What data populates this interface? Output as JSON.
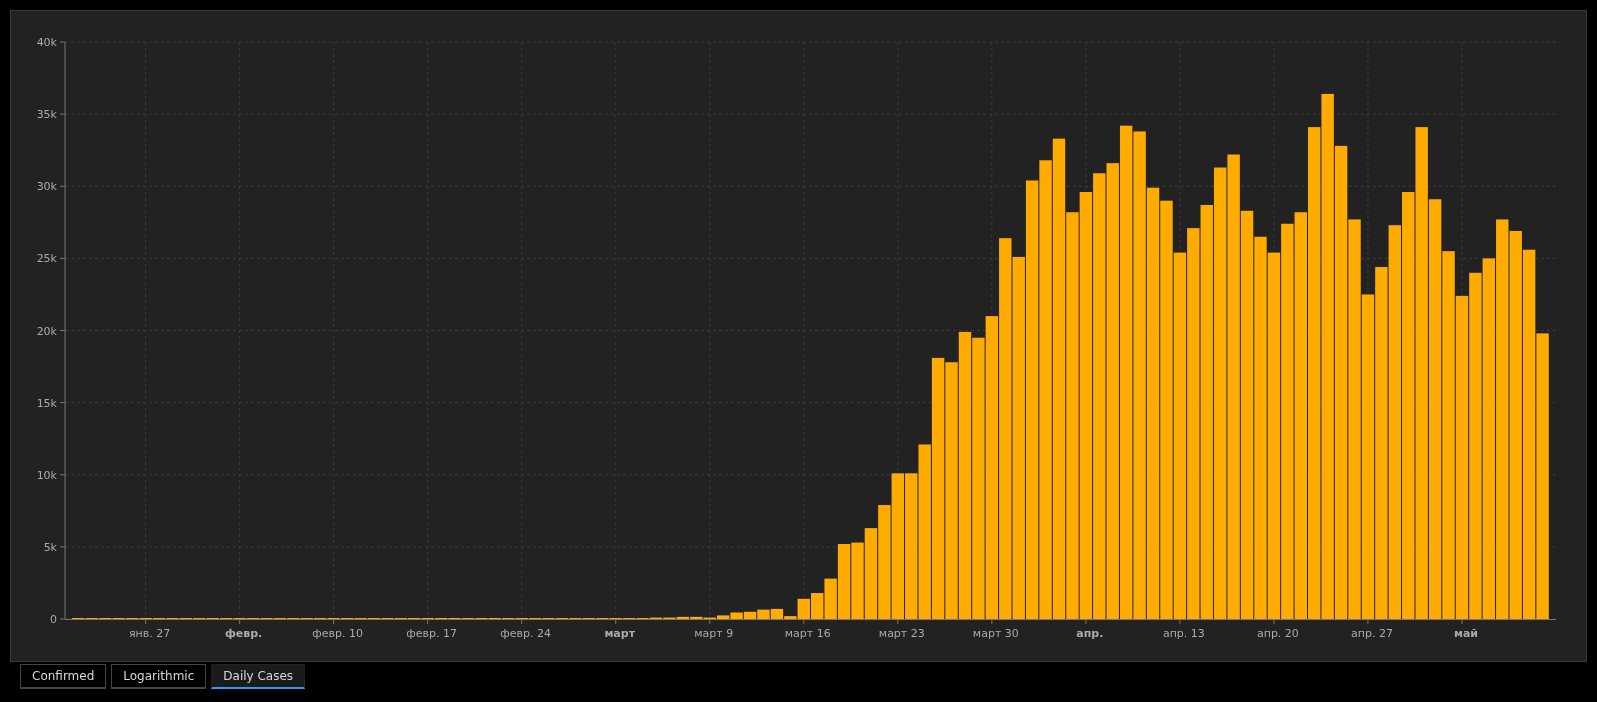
{
  "chart_data": {
    "type": "bar",
    "grid": true,
    "x": [
      "--01-22",
      "--01-23",
      "--01-24",
      "--01-25",
      "--01-26",
      "--01-27",
      "--01-28",
      "--01-29",
      "--01-30",
      "--01-31",
      "--02-01",
      "--02-02",
      "--02-03",
      "--02-04",
      "--02-05",
      "--02-06",
      "--02-07",
      "--02-08",
      "--02-09",
      "--02-10",
      "--02-11",
      "--02-12",
      "--02-13",
      "--02-14",
      "--02-15",
      "--02-16",
      "--02-17",
      "--02-18",
      "--02-19",
      "--02-20",
      "--02-21",
      "--02-22",
      "--02-23",
      "--02-24",
      "--02-25",
      "--02-26",
      "--02-27",
      "--02-28",
      "--02-29",
      "--03-01",
      "--03-02",
      "--03-03",
      "--03-04",
      "--03-05",
      "--03-06",
      "--03-07",
      "--03-08",
      "--03-09",
      "--03-10",
      "--03-11",
      "--03-12",
      "--03-13",
      "--03-14",
      "--03-15",
      "--03-16",
      "--03-17",
      "--03-18",
      "--03-19",
      "--03-20",
      "--03-21",
      "--03-22",
      "--03-23",
      "--03-24",
      "--03-25",
      "--03-26",
      "--03-27",
      "--03-28",
      "--03-29",
      "--03-30",
      "--03-31",
      "--04-01",
      "--04-02",
      "--04-03",
      "--04-04",
      "--04-05",
      "--04-06",
      "--04-07",
      "--04-08",
      "--04-09",
      "--04-10",
      "--04-11",
      "--04-12",
      "--04-13",
      "--04-14",
      "--04-15",
      "--04-16",
      "--04-17",
      "--04-18",
      "--04-19",
      "--04-20",
      "--04-21",
      "--04-22",
      "--04-23",
      "--04-24",
      "--04-25",
      "--04-26",
      "--04-27",
      "--04-28",
      "--04-29",
      "--04-30",
      "--05-01",
      "--05-02",
      "--05-03",
      "--05-04",
      "--05-05",
      "--05-06",
      "--05-07",
      "--05-08",
      "--05-09",
      "--05-10"
    ],
    "series": [
      {
        "color": "#ffab00",
        "values": [
          0,
          0,
          0,
          0,
          0,
          0,
          0,
          0,
          0,
          0,
          0,
          0,
          0,
          0,
          0,
          0,
          0,
          0,
          0,
          0,
          0,
          0,
          0,
          0,
          0,
          0,
          0,
          0,
          0,
          0,
          0,
          0,
          0,
          0,
          0,
          0,
          0,
          0,
          0,
          20,
          30,
          40,
          60,
          100,
          100,
          150,
          150,
          100,
          250,
          450,
          500,
          650,
          700,
          200,
          1400,
          1800,
          2800,
          5200,
          5300,
          6300,
          7900,
          10100,
          10100,
          12100,
          18100,
          17800,
          19900,
          19500,
          21000,
          26400,
          25100,
          30400,
          31800,
          33300,
          28200,
          29600,
          30900,
          31600,
          34200,
          33800,
          29900,
          29000,
          25400,
          27100,
          28700,
          31300,
          32200,
          28300,
          26500,
          25400,
          27400,
          28200,
          34100,
          36400,
          32800,
          27700,
          22500,
          24400,
          27300,
          29600,
          34100,
          29100,
          25500,
          22400,
          24000,
          25000,
          27700,
          26900,
          25600,
          19800
        ]
      }
    ],
    "xlim": [
      "--01-21",
      "--05-11"
    ],
    "ylim": [
      0,
      40000
    ],
    "yticks": [
      {
        "value": 0,
        "label": "0"
      },
      {
        "value": 5000,
        "label": "5k"
      },
      {
        "value": 10000,
        "label": "10k"
      },
      {
        "value": 15000,
        "label": "15k"
      },
      {
        "value": 20000,
        "label": "20k"
      },
      {
        "value": 25000,
        "label": "25k"
      },
      {
        "value": 30000,
        "label": "30k"
      },
      {
        "value": 35000,
        "label": "35k"
      },
      {
        "value": 40000,
        "label": "40k"
      }
    ],
    "xticks": [
      {
        "value": "--01-27",
        "label": "янв. 27"
      },
      {
        "value": "--02-03",
        "label": "**февр.**"
      },
      {
        "value": "--02-10",
        "label": "февр. 10"
      },
      {
        "value": "--02-17",
        "label": "февр. 17"
      },
      {
        "value": "--02-24",
        "label": "февр. 24"
      },
      {
        "value": "--03-02",
        "label": "**март**"
      },
      {
        "value": "--03-09",
        "label": "март 9"
      },
      {
        "value": "--03-16",
        "label": "март 16"
      },
      {
        "value": "--03-23",
        "label": "март 23"
      },
      {
        "value": "--03-30",
        "label": "март 30"
      },
      {
        "value": "--04-06",
        "label": "**апр.**"
      },
      {
        "value": "--04-13",
        "label": "апр. 13"
      },
      {
        "value": "--04-20",
        "label": "апр. 20"
      },
      {
        "value": "--04-27",
        "label": "апр. 27"
      },
      {
        "value": "--05-04",
        "label": "**май**"
      }
    ]
  },
  "tabs": [
    {
      "label": "Confirmed",
      "selected": false
    },
    {
      "label": "Logarithmic",
      "selected": false
    },
    {
      "label": "Daily Cases",
      "selected": true
    }
  ]
}
